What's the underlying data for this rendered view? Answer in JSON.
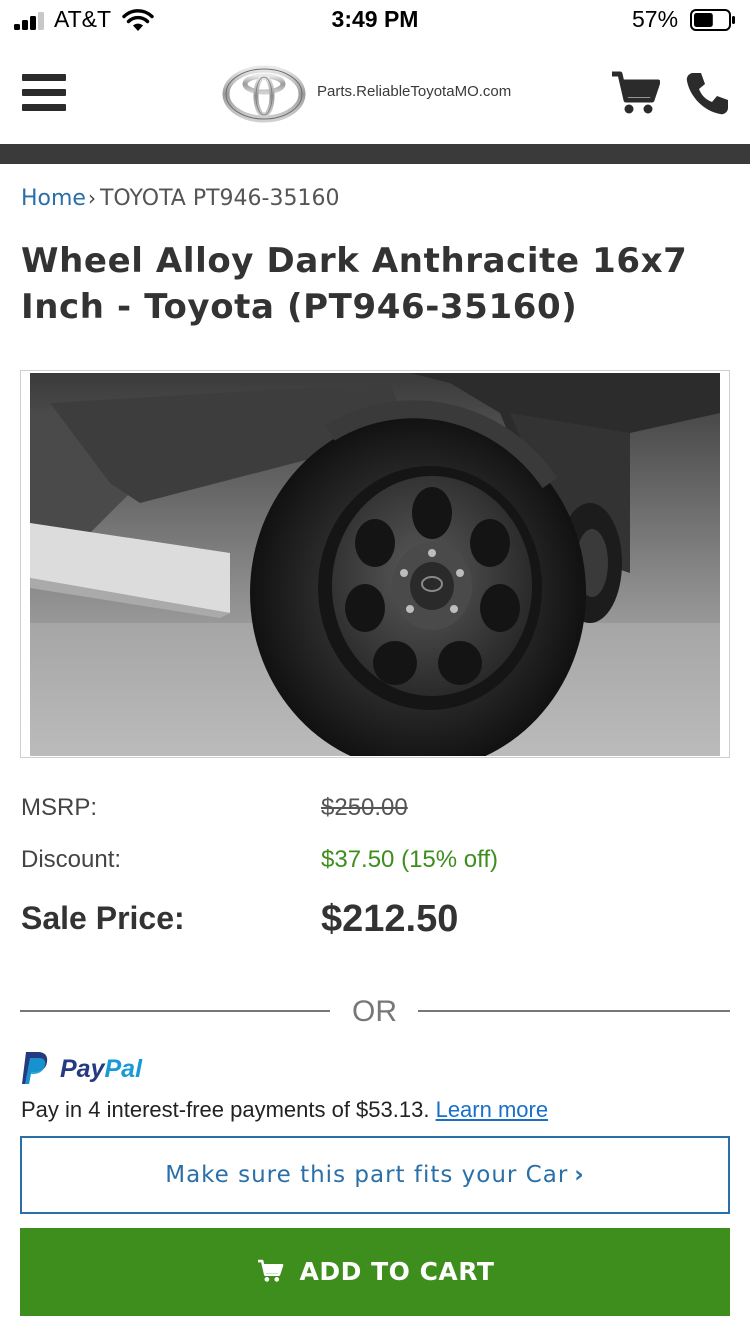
{
  "status_bar": {
    "carrier": "AT&T",
    "time": "3:49 PM",
    "battery_percent": "57%",
    "battery_level": 0.57,
    "signal_bars": 3
  },
  "header": {
    "site_name": "Parts.ReliableToyotaMO.com",
    "icons": [
      "menu-icon",
      "toyota-logo",
      "cart-icon",
      "phone-icon"
    ]
  },
  "breadcrumb": {
    "home": "Home",
    "current": "TOYOTA PT946-35160"
  },
  "product": {
    "title": "Wheel Alloy Dark Anthracite 16x7 Inch - Toyota (PT946-35160)"
  },
  "pricing": {
    "msrp_label": "MSRP:",
    "msrp_value": "$250.00",
    "discount_label": "Discount:",
    "discount_value": "$37.50 (15% off)",
    "sale_label": "Sale Price:",
    "sale_value": "$212.50"
  },
  "divider": {
    "or": "OR"
  },
  "paypal": {
    "brand_pay": "Pay",
    "brand_pal": "Pal",
    "message": "Pay in 4 interest-free payments of $53.13.",
    "learn_more": "Learn more"
  },
  "buttons": {
    "fit_check": "Make sure this part fits your Car",
    "add_to_cart": "ADD TO CART"
  },
  "colors": {
    "link_blue": "#2a6fa8",
    "discount_green": "#3e8e1e",
    "cta_green": "#3e8e1e",
    "paypal_dark": "#253b80",
    "paypal_light": "#179bd7"
  }
}
